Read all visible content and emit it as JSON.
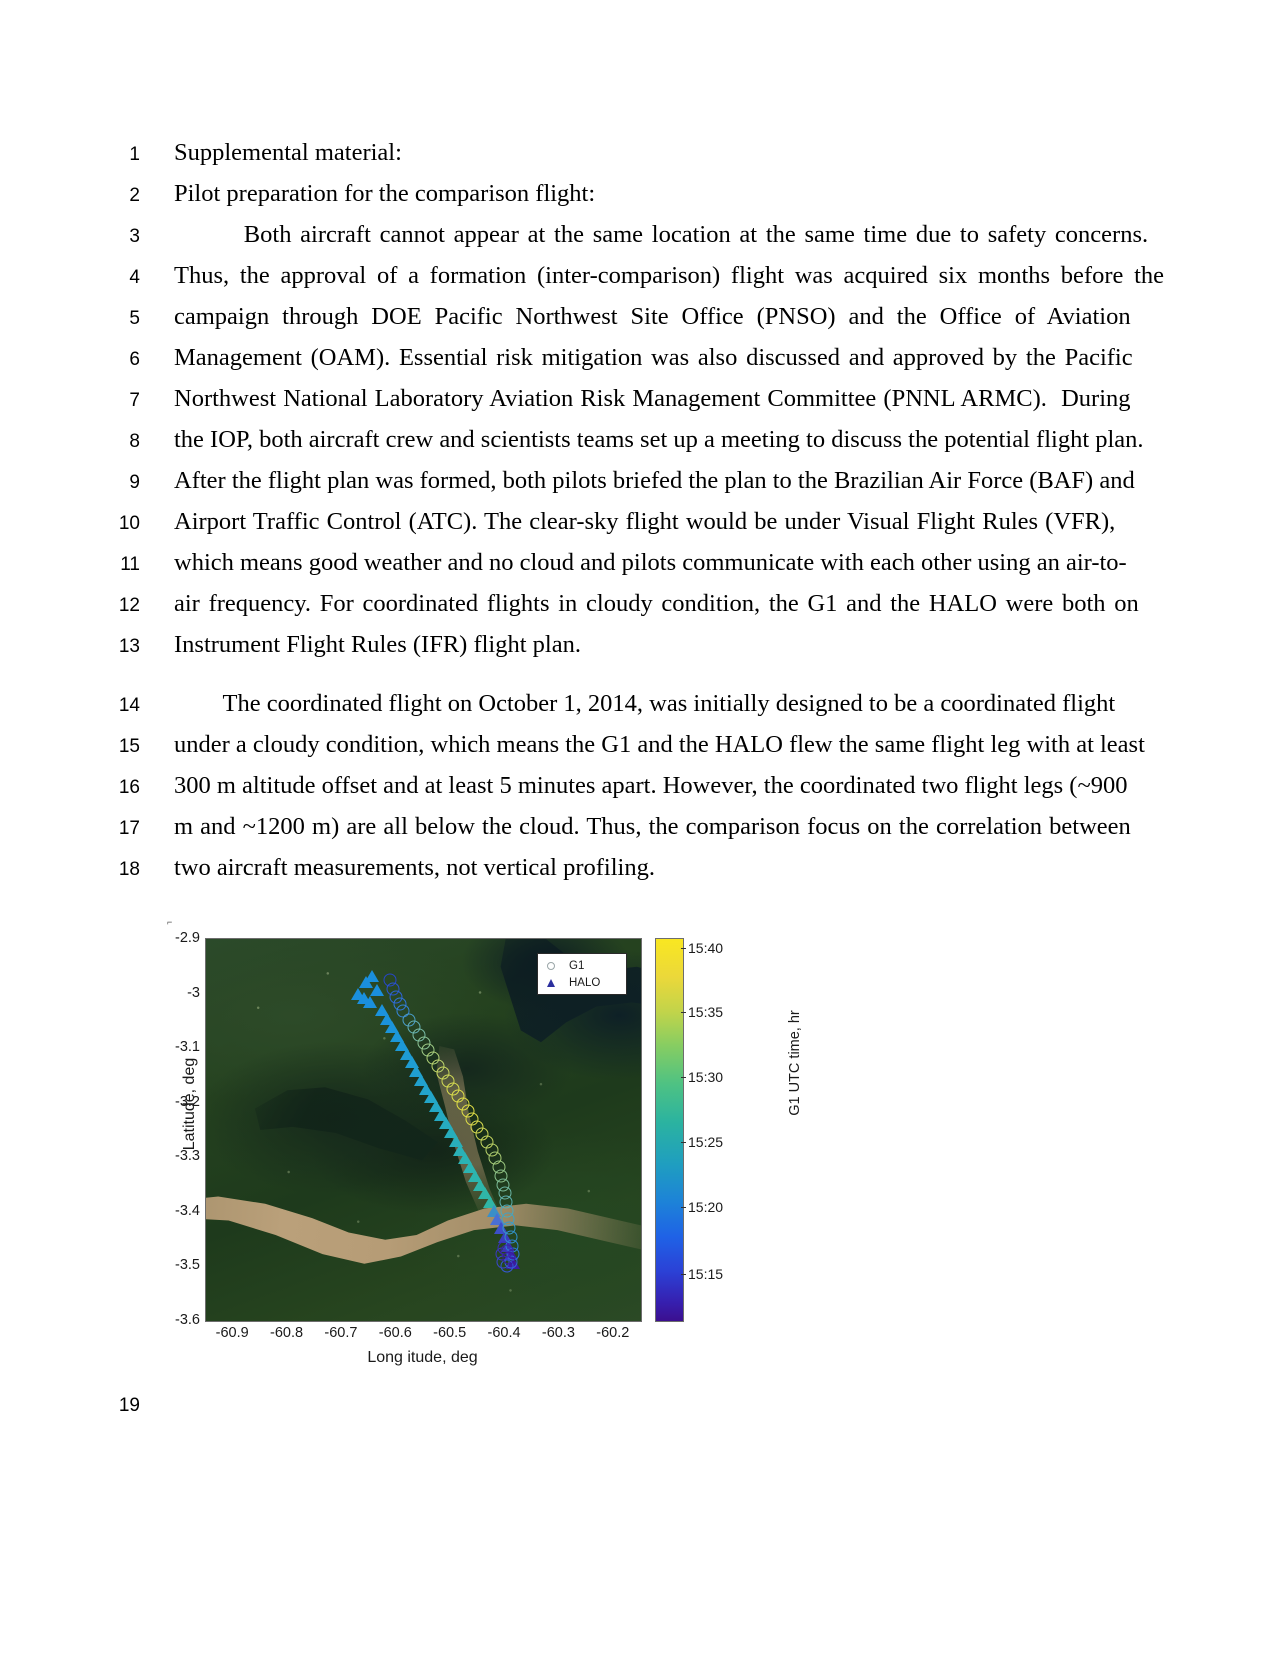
{
  "document": {
    "paragraphs": [
      {
        "number": "1",
        "text": "Supplemental material:",
        "indent": false,
        "spacing": 0
      },
      {
        "number": "2",
        "text": "Pilot preparation for the comparison flight:",
        "indent": false,
        "spacing": 0
      },
      {
        "number": "3",
        "text": "        Both aircraft cannot appear at the same location at the same time due to safety concerns.",
        "indent": true,
        "spacing": 2
      },
      {
        "number": "4",
        "text": "Thus, the approval of a formation (inter-comparison) flight was acquired six months before the",
        "indent": false,
        "spacing": 3
      },
      {
        "number": "5",
        "text": "campaign through DOE Pacific Northwest Site Office (PNSO) and the Office of Aviation",
        "indent": false,
        "spacing": 4
      },
      {
        "number": "6",
        "text": "Management (OAM). Essential risk mitigation was also discussed and approved by the Pacific",
        "indent": false,
        "spacing": 2
      },
      {
        "number": "7",
        "text": "Northwest National Laboratory Aviation Risk Management Committee (PNNL ARMC).  During",
        "indent": false,
        "spacing": 1
      },
      {
        "number": "8",
        "text": "the IOP, both aircraft crew and scientists teams set up a meeting to discuss the potential flight plan.",
        "indent": false,
        "spacing": 0
      },
      {
        "number": "9",
        "text": "After the flight plan was formed, both pilots briefed the plan to the Brazilian Air Force (BAF) and",
        "indent": false,
        "spacing": 0
      },
      {
        "number": "10",
        "text": "Airport Traffic Control (ATC). The clear-sky flight would be under Visual Flight Rules (VFR),",
        "indent": false,
        "spacing": 1
      },
      {
        "number": "11",
        "text": "which means good weather and no cloud and pilots communicate with each other using an air-to-",
        "indent": false,
        "spacing": 0
      },
      {
        "number": "12",
        "text": "air frequency. For coordinated flights in cloudy condition, the G1 and the HALO were both on",
        "indent": false,
        "spacing": 2
      },
      {
        "number": "13",
        "text": "Instrument Flight Rules (IFR) flight plan.",
        "indent": false,
        "spacing": 0
      },
      {
        "number": "14",
        "text": "        The coordinated flight on October 1, 2014, was initially designed to be a coordinated flight",
        "indent": true,
        "spacing": 0,
        "para_break": true
      },
      {
        "number": "15",
        "text": "under a cloudy condition, which means the G1 and the HALO flew the same flight leg with at least",
        "indent": false,
        "spacing": 0
      },
      {
        "number": "16",
        "text": "300 m altitude offset and at least 5 minutes apart. However, the coordinated two flight legs (~900",
        "indent": false,
        "spacing": 0
      },
      {
        "number": "17",
        "text": "m and ~1200 m) are all below the cloud. Thus, the comparison focus on the correlation between",
        "indent": false,
        "spacing": 1
      },
      {
        "number": "18",
        "text": "two aircraft measurements, not vertical profiling.",
        "indent": false,
        "spacing": 0
      }
    ],
    "figure_line_number": "19"
  },
  "chart_data": {
    "type": "scatter",
    "title": "",
    "xlabel": "Long itude, deg",
    "ylabel": "Latitude, deg",
    "xlim": [
      -60.95,
      -60.15
    ],
    "ylim": [
      -3.6,
      -2.9
    ],
    "xticks": [
      "-60.9",
      "-60.8",
      "-60.7",
      "-60.6",
      "-60.5",
      "-60.4",
      "-60.3",
      "-60.2"
    ],
    "xtick_values": [
      -60.9,
      -60.8,
      -60.7,
      -60.6,
      -60.5,
      -60.4,
      -60.3,
      -60.2
    ],
    "yticks": [
      "-2.9",
      "-3",
      "-3.1",
      "-3.2",
      "-3.3",
      "-3.4",
      "-3.5",
      "-3.6"
    ],
    "ytick_values": [
      -2.9,
      -3.0,
      -3.1,
      -3.2,
      -3.3,
      -3.4,
      -3.5,
      -3.6
    ],
    "grid": false,
    "basemap": "satellite-imagery",
    "legend": {
      "position": "top-right",
      "entries": [
        {
          "label": "G1",
          "marker": "circle-open"
        },
        {
          "label": "HALO",
          "marker": "triangle-filled"
        }
      ]
    },
    "colorbar": {
      "label": "G1 UTC time, hr",
      "colormap": "parula",
      "ticks": [
        "15:15",
        "15:20",
        "15:25",
        "15:30",
        "15:35",
        "15:40"
      ],
      "tick_positions": [
        0.12,
        0.295,
        0.465,
        0.635,
        0.805,
        0.975
      ],
      "min": "15:13",
      "max": "15:42"
    },
    "series": [
      {
        "name": "HALO",
        "marker": "triangle",
        "lon": [
          -60.655,
          -60.644,
          -60.67,
          -60.635,
          -60.66,
          -60.649,
          -60.626,
          -60.617,
          -60.608,
          -60.599,
          -60.59,
          -60.581,
          -60.572,
          -60.563,
          -60.554,
          -60.545,
          -60.536,
          -60.527,
          -60.518,
          -60.509,
          -60.5,
          -60.491,
          -60.482,
          -60.473,
          -60.464,
          -60.455,
          -60.446,
          -60.437,
          -60.428,
          -60.421,
          -60.414,
          -60.407,
          -60.4,
          -60.395,
          -60.39,
          -60.386
        ],
        "lat": [
          -2.978,
          -2.968,
          -3.0,
          -2.994,
          -3.008,
          -3.016,
          -3.03,
          -3.046,
          -3.062,
          -3.078,
          -3.094,
          -3.11,
          -3.126,
          -3.142,
          -3.158,
          -3.174,
          -3.19,
          -3.206,
          -3.222,
          -3.238,
          -3.254,
          -3.27,
          -3.286,
          -3.302,
          -3.318,
          -3.334,
          -3.35,
          -3.366,
          -3.382,
          -3.398,
          -3.414,
          -3.43,
          -3.446,
          -3.462,
          -3.478,
          -3.494
        ],
        "color": [
          "#1a8fdd",
          "#1a8fdd",
          "#1a8fdd",
          "#1a8fdd",
          "#1a8fdd",
          "#1a8fdd",
          "#1b92dc",
          "#1b93db",
          "#1c95da",
          "#1c97d8",
          "#1d99d6",
          "#1e9bd4",
          "#1f9dd2",
          "#209fd0",
          "#21a1ce",
          "#22a3cb",
          "#23a5c8",
          "#24a7c5",
          "#25a9c2",
          "#26abbf",
          "#27adbc",
          "#29afba",
          "#2ab1b7",
          "#2bb3b4",
          "#2cb4b1",
          "#2db5ae",
          "#2eb6ab",
          "#2fb6a8",
          "#30b6a5",
          "#3a8fc8",
          "#4a6fd4",
          "#3c4fc9",
          "#3b3fbe",
          "#3a36b4",
          "#3922aa",
          "#3b1c9f"
        ]
      },
      {
        "name": "G1",
        "marker": "circle",
        "lon": [
          -60.612,
          -60.606,
          -60.6,
          -60.594,
          -60.587,
          -60.577,
          -60.568,
          -60.559,
          -60.55,
          -60.541,
          -60.532,
          -60.523,
          -60.514,
          -60.505,
          -60.496,
          -60.487,
          -60.478,
          -60.469,
          -60.46,
          -60.451,
          -60.442,
          -60.433,
          -60.424,
          -60.418,
          -60.412,
          -60.408,
          -60.404,
          -60.401,
          -60.398,
          -60.396,
          -60.394,
          -60.392,
          -60.39,
          -60.388,
          -60.386,
          -60.39,
          -60.397,
          -60.403,
          -60.406,
          -60.402,
          -60.396,
          -60.392
        ],
        "lat": [
          -2.975,
          -2.992,
          -3.007,
          -3.02,
          -3.032,
          -3.048,
          -3.062,
          -3.076,
          -3.09,
          -3.104,
          -3.118,
          -3.132,
          -3.146,
          -3.16,
          -3.174,
          -3.188,
          -3.202,
          -3.216,
          -3.23,
          -3.244,
          -3.258,
          -3.272,
          -3.286,
          -3.302,
          -3.318,
          -3.334,
          -3.35,
          -3.366,
          -3.382,
          -3.398,
          -3.414,
          -3.43,
          -3.446,
          -3.462,
          -3.478,
          -3.492,
          -3.5,
          -3.492,
          -3.478,
          -3.466,
          -3.472,
          -3.484
        ],
        "color": [
          "#2746c9",
          "#2a55d2",
          "#2d65da",
          "#3075dd",
          "#3585d9",
          "#4a9ecb",
          "#63b0b8",
          "#79bca8",
          "#8cc596",
          "#9ecb86",
          "#aed077",
          "#bdd46b",
          "#c9d860",
          "#d1da56",
          "#d8dc4e",
          "#ddde49",
          "#e0df46",
          "#e1df46",
          "#dedd48",
          "#d8db4e",
          "#cfd856",
          "#c4d55f",
          "#b7d169",
          "#a9cc74",
          "#9ac780",
          "#8bc28c",
          "#7bbc99",
          "#6bb6a5",
          "#5cb0b1",
          "#4da9bb",
          "#41a1c3",
          "#379ac9",
          "#3091ce",
          "#2d86d3",
          "#2e79d6",
          "#3168d8",
          "#3557d6",
          "#3a48ce",
          "#3c3ac3",
          "#3b2eb6",
          "#3a24a9",
          "#3a189c"
        ]
      }
    ]
  }
}
